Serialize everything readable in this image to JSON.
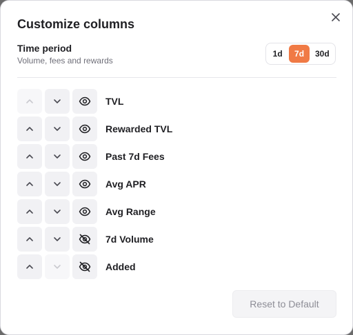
{
  "modal": {
    "title": "Customize columns",
    "time_period": {
      "title": "Time period",
      "subtitle": "Volume, fees and rewards",
      "options": [
        "1d",
        "7d",
        "30d"
      ],
      "selected": "7d"
    },
    "columns": [
      {
        "label": "TVL",
        "visible": true,
        "up_enabled": false,
        "down_enabled": true
      },
      {
        "label": "Rewarded TVL",
        "visible": true,
        "up_enabled": true,
        "down_enabled": true
      },
      {
        "label": "Past 7d Fees",
        "visible": true,
        "up_enabled": true,
        "down_enabled": true
      },
      {
        "label": "Avg APR",
        "visible": true,
        "up_enabled": true,
        "down_enabled": true
      },
      {
        "label": "Avg Range",
        "visible": true,
        "up_enabled": true,
        "down_enabled": true
      },
      {
        "label": "7d Volume",
        "visible": false,
        "up_enabled": true,
        "down_enabled": true
      },
      {
        "label": "Added",
        "visible": false,
        "up_enabled": true,
        "down_enabled": false
      }
    ],
    "reset_label": "Reset to Default"
  },
  "colors": {
    "accent": "#f07a45",
    "text": "#1f1f23",
    "muted": "#6e6e78",
    "button_bg": "#f1f1f4"
  },
  "icons": {
    "close": "close-icon",
    "up": "chevron-up-icon",
    "down": "chevron-down-icon",
    "visible": "eye-icon",
    "hidden": "eye-off-icon"
  }
}
